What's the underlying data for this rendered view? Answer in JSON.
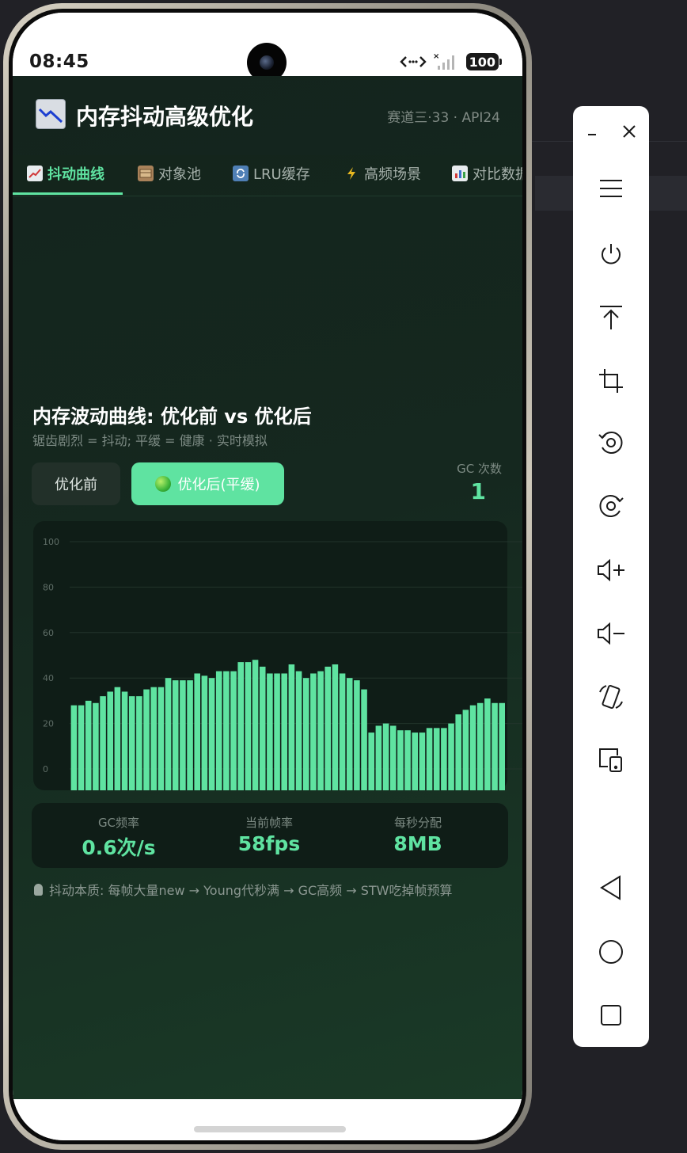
{
  "status_bar": {
    "time": "08:45",
    "battery": "100"
  },
  "app": {
    "title": "内存抖动高级优化",
    "meta": "赛道三·33 · API24",
    "logo_icon": "chart-decreasing-icon"
  },
  "tabs": [
    {
      "label": "抖动曲线",
      "icon": "chart-increasing-icon",
      "active": true
    },
    {
      "label": "对象池",
      "icon": "card-file-box-icon",
      "active": false
    },
    {
      "label": "LRU缓存",
      "icon": "refresh-icon",
      "active": false
    },
    {
      "label": "高频场景",
      "icon": "lightning-icon",
      "active": false
    },
    {
      "label": "对比数据",
      "icon": "bar-chart-icon",
      "active": false
    }
  ],
  "section": {
    "title": "内存波动曲线: 优化前 vs 优化后",
    "subtitle": "锯齿剧烈 = 抖动; 平缓 = 健康 · 实时模拟"
  },
  "toggle": {
    "before_label": "优化前",
    "after_label": "优化后(平缓)",
    "selected": "after"
  },
  "gc_count": {
    "label": "GC 次数",
    "value": "1"
  },
  "chart_data": {
    "type": "bar",
    "ylim": [
      0,
      100
    ],
    "yticks": [
      "0",
      "20",
      "40",
      "60",
      "80",
      "100"
    ],
    "grid": true,
    "bar_color": "#5fe3a1",
    "values": [
      28,
      28,
      30,
      29,
      32,
      34,
      36,
      34,
      32,
      32,
      35,
      36,
      36,
      40,
      39,
      39,
      39,
      42,
      41,
      40,
      43,
      43,
      43,
      47,
      47,
      48,
      45,
      42,
      42,
      42,
      46,
      43,
      40,
      42,
      43,
      45,
      46,
      42,
      40,
      39,
      35,
      16,
      19,
      20,
      19,
      17,
      17,
      16,
      16,
      18,
      18,
      18,
      20,
      24,
      26,
      28,
      29,
      31,
      29,
      29
    ]
  },
  "stats": [
    {
      "label": "GC频率",
      "value": "0.6次/s"
    },
    {
      "label": "当前帧率",
      "value": "58fps"
    },
    {
      "label": "每秒分配",
      "value": "8MB"
    }
  ],
  "tip": "抖动本质: 每帧大量new → Young代秒满 → GC高频 → STW吃掉帧预算",
  "colors": {
    "accent": "#5fe3a1",
    "background": "#14241d"
  },
  "sidebar": [
    {
      "name": "minimize-icon"
    },
    {
      "name": "close-icon"
    },
    {
      "name": "menu-icon"
    },
    {
      "name": "power-icon"
    },
    {
      "name": "upload-icon"
    },
    {
      "name": "crop-icon"
    },
    {
      "name": "rotate-left-icon"
    },
    {
      "name": "rotate-right-icon"
    },
    {
      "name": "volume-up-icon"
    },
    {
      "name": "volume-down-icon"
    },
    {
      "name": "screen-rotate-icon"
    },
    {
      "name": "devices-icon"
    },
    {
      "name": "back-icon"
    },
    {
      "name": "home-icon"
    },
    {
      "name": "recents-icon"
    }
  ]
}
